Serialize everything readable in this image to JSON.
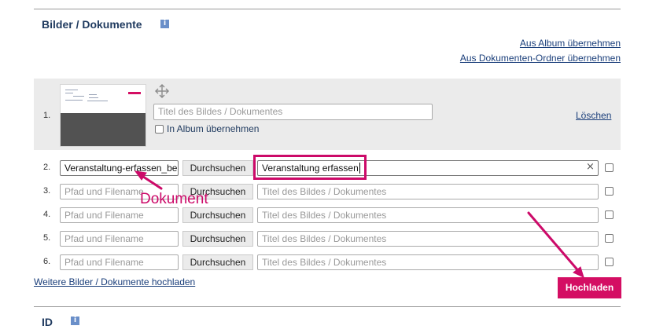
{
  "section_bilder": {
    "title": "Bilder / Dokumente",
    "info_icon": "i",
    "link_album": "Aus Album übernehmen",
    "link_ordner": "Aus Dokumenten-Ordner übernehmen"
  },
  "existing_item": {
    "number": "1.",
    "title_placeholder": "Titel des Bildes / Dokumentes",
    "album_checkbox_label": "In Album übernehmen",
    "delete_link": "Löschen"
  },
  "upload_rows": [
    {
      "number": "2.",
      "file_value": "Veranstaltung-erfassen_be",
      "browse_label": "Durchsuchen",
      "title_value": "Veranstaltung erfassen"
    },
    {
      "number": "3.",
      "file_placeholder": "Pfad und Filename",
      "browse_label": "Durchsuchen",
      "title_placeholder": "Titel des Bildes / Dokumentes"
    },
    {
      "number": "4.",
      "file_placeholder": "Pfad und Filename",
      "browse_label": "Durchsuchen",
      "title_placeholder": "Titel des Bildes / Dokumentes"
    },
    {
      "number": "5.",
      "file_placeholder": "Pfad und Filename",
      "browse_label": "Durchsuchen",
      "title_placeholder": "Titel des Bildes / Dokumentes"
    },
    {
      "number": "6.",
      "file_placeholder": "Pfad und Filename",
      "browse_label": "Durchsuchen",
      "title_placeholder": "Titel des Bildes / Dokumentes"
    }
  ],
  "more_link": "Weitere Bilder / Dokumente hochladen",
  "upload_button": "Hochladen",
  "annotation_text": "Dokument",
  "clear_icon": "×",
  "section_id": {
    "title": "ID",
    "info_icon": "i"
  },
  "colors": {
    "accent": "#d40e63",
    "heading": "#1f3a5f",
    "link": "#1a3e7a"
  }
}
